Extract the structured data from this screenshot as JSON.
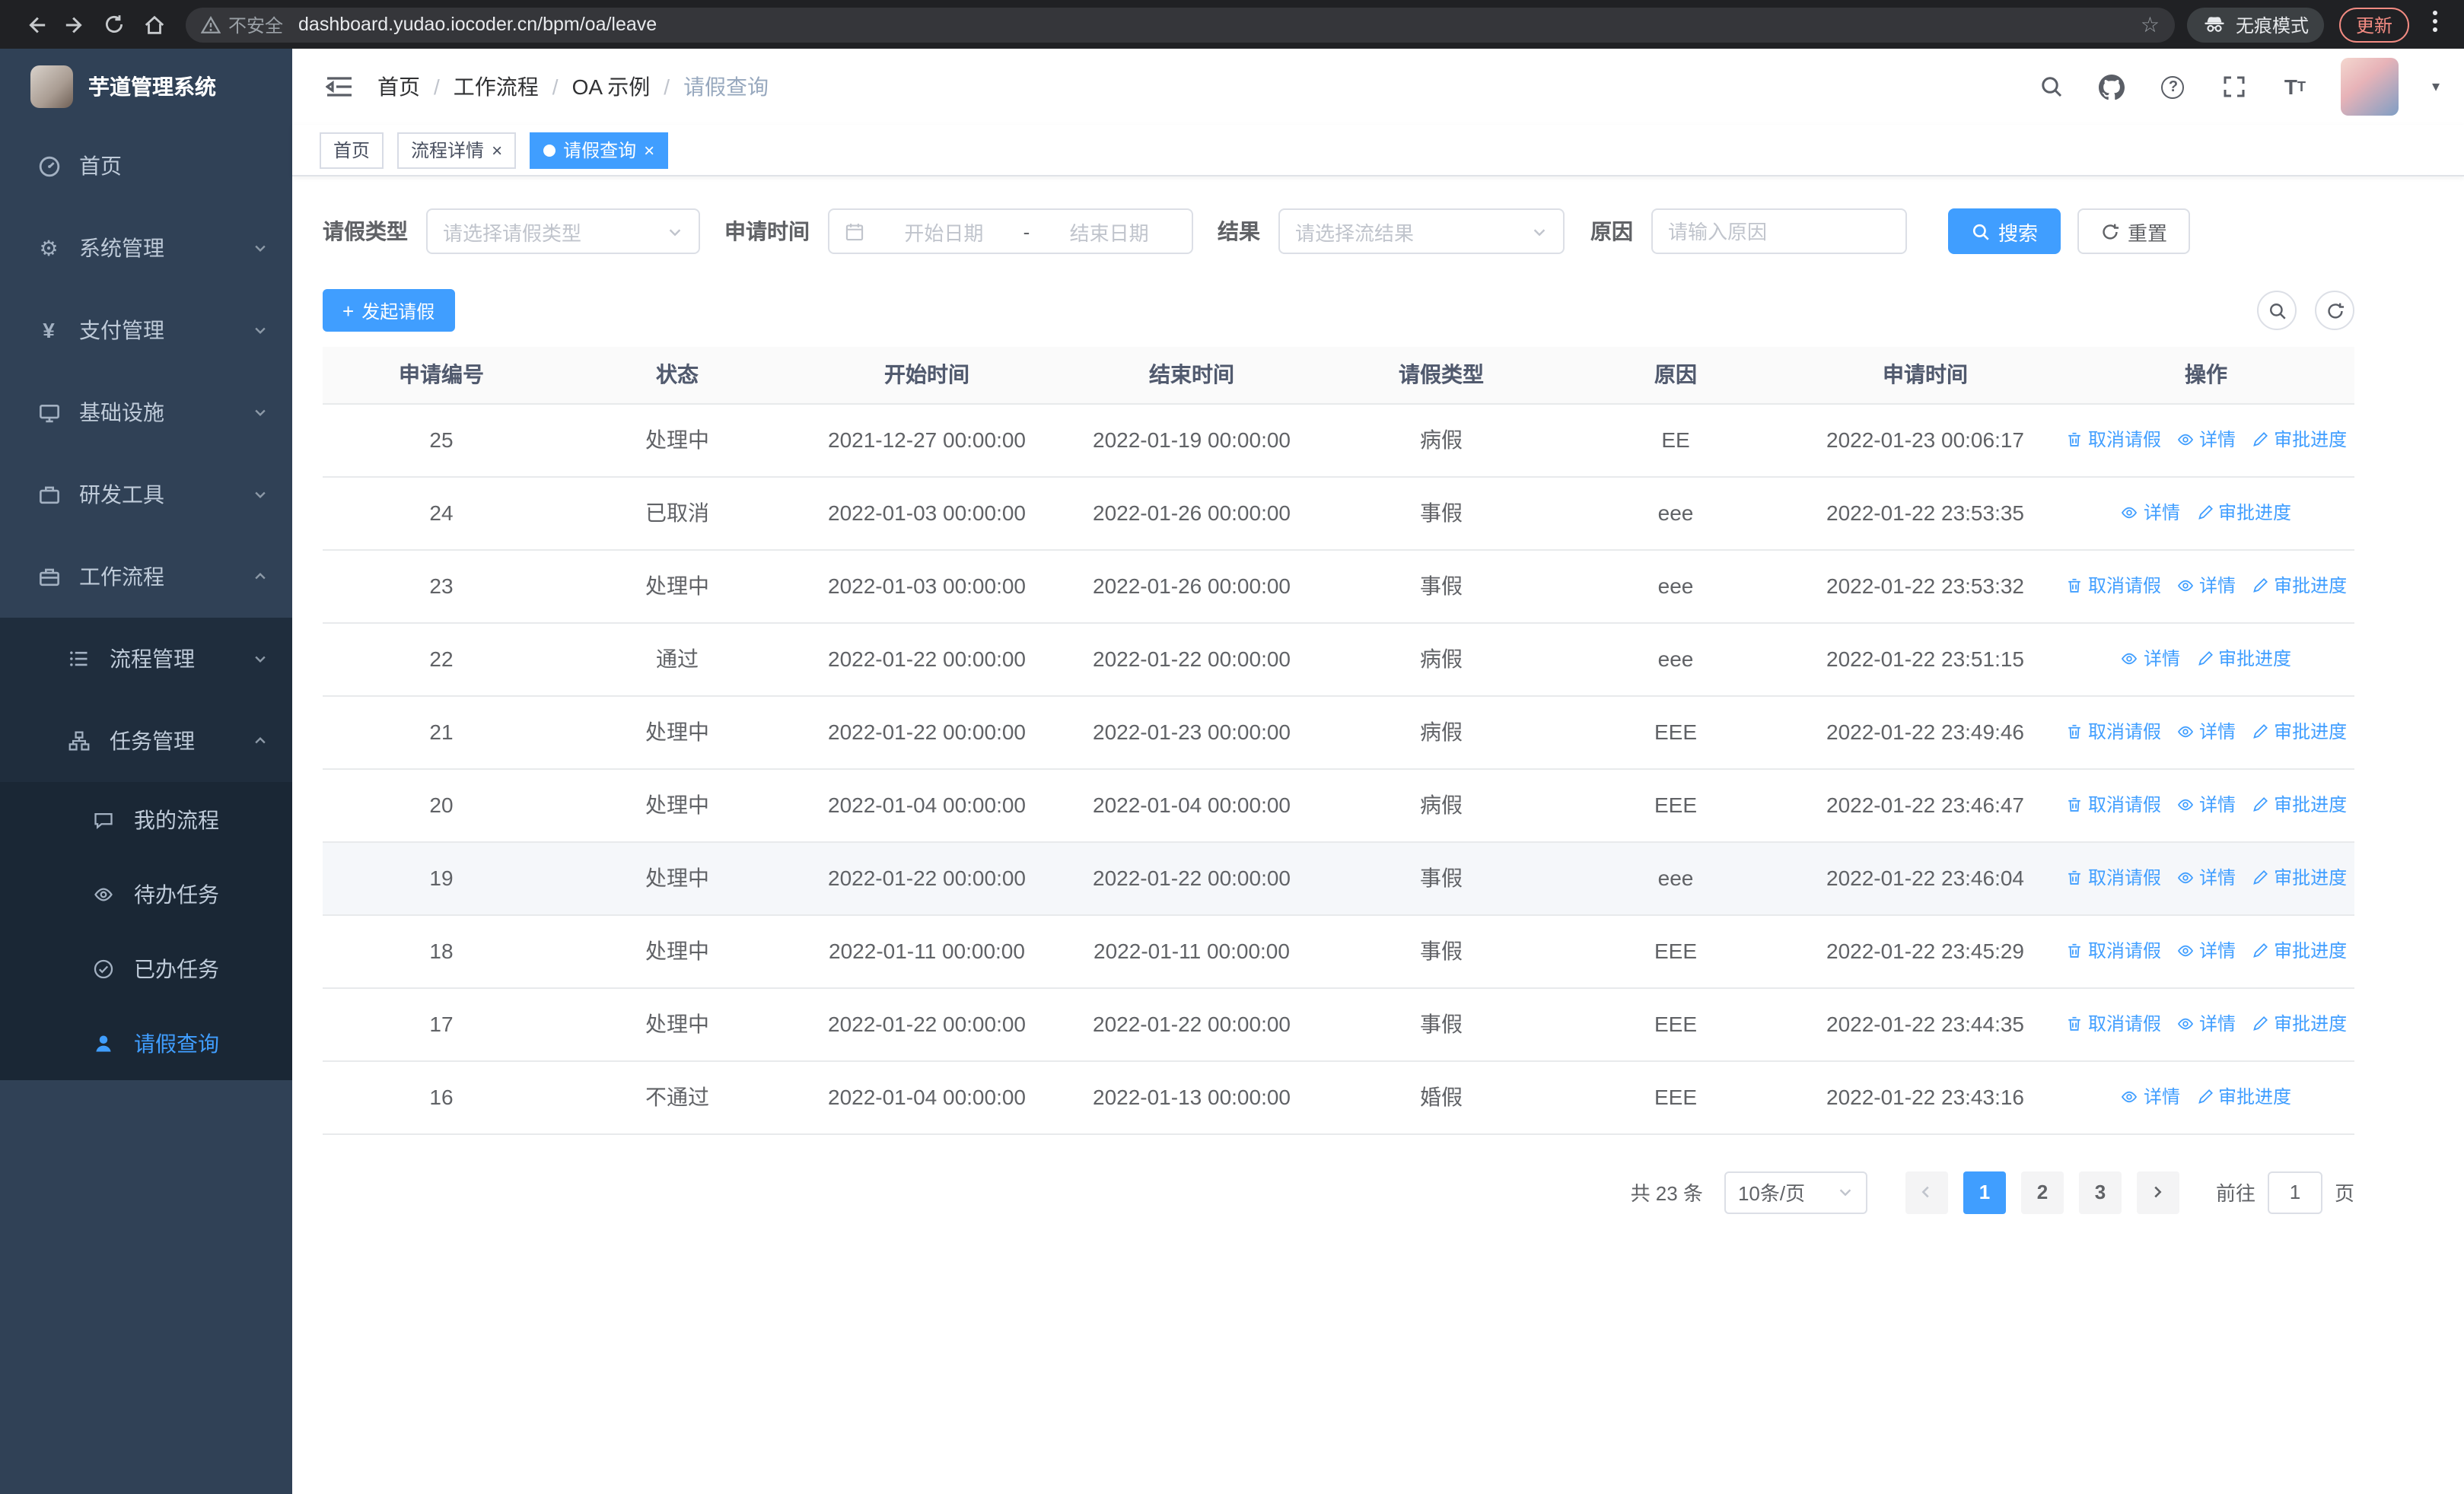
{
  "colors": {
    "accent": "#409eff",
    "sidebar_bg": "#304156",
    "submenu_bg": "#1f2d3d",
    "danger": "#f28b82"
  },
  "browser": {
    "security_warning": "不安全",
    "url": "dashboard.yudao.iocoder.cn/bpm/oa/leave",
    "incognito_label": "无痕模式",
    "update_label": "更新"
  },
  "sidebar": {
    "logo_title": "芋道管理系统",
    "menu": [
      {
        "label": "首页"
      },
      {
        "label": "系统管理"
      },
      {
        "label": "支付管理"
      },
      {
        "label": "基础设施"
      },
      {
        "label": "研发工具"
      },
      {
        "label": "工作流程"
      }
    ],
    "process_mgmt": "流程管理",
    "task_mgmt": "任务管理",
    "task_items": [
      {
        "label": "我的流程"
      },
      {
        "label": "待办任务"
      },
      {
        "label": "已办任务"
      },
      {
        "label": "请假查询"
      }
    ]
  },
  "header": {
    "breadcrumb": {
      "home": "首页",
      "workflow": "工作流程",
      "oa": "OA 示例",
      "current": "请假查询"
    }
  },
  "tabs": [
    {
      "label": "首页",
      "active": false,
      "closable": false
    },
    {
      "label": "流程详情",
      "active": false,
      "closable": true
    },
    {
      "label": "请假查询",
      "active": true,
      "closable": true
    }
  ],
  "filters": {
    "leave_type_label": "请假类型",
    "leave_type_placeholder": "请选择请假类型",
    "apply_time_label": "申请时间",
    "start_date_placeholder": "开始日期",
    "date_separator": "-",
    "end_date_placeholder": "结束日期",
    "result_label": "结果",
    "result_placeholder": "请选择流结果",
    "reason_label": "原因",
    "reason_placeholder": "请输入原因",
    "search_button": "搜索",
    "reset_button": "重置"
  },
  "toolbar": {
    "create_button": "发起请假"
  },
  "table": {
    "columns": [
      "申请编号",
      "状态",
      "开始时间",
      "结束时间",
      "请假类型",
      "原因",
      "申请时间",
      "操作"
    ],
    "column_keys": [
      "id",
      "status",
      "start",
      "end",
      "type",
      "reason",
      "applied"
    ],
    "action_labels": {
      "cancel": "取消请假",
      "detail": "详情",
      "progress": "审批进度"
    },
    "rows": [
      {
        "id": "25",
        "status": "处理中",
        "start": "2021-12-27 00:00:00",
        "end": "2022-01-19 00:00:00",
        "type": "病假",
        "reason": "EE",
        "applied": "2022-01-23 00:06:17",
        "actions": [
          "cancel",
          "detail",
          "progress"
        ],
        "highlighted": false
      },
      {
        "id": "24",
        "status": "已取消",
        "start": "2022-01-03 00:00:00",
        "end": "2022-01-26 00:00:00",
        "type": "事假",
        "reason": "eee",
        "applied": "2022-01-22 23:53:35",
        "actions": [
          "detail",
          "progress"
        ],
        "highlighted": false
      },
      {
        "id": "23",
        "status": "处理中",
        "start": "2022-01-03 00:00:00",
        "end": "2022-01-26 00:00:00",
        "type": "事假",
        "reason": "eee",
        "applied": "2022-01-22 23:53:32",
        "actions": [
          "cancel",
          "detail",
          "progress"
        ],
        "highlighted": false
      },
      {
        "id": "22",
        "status": "通过",
        "start": "2022-01-22 00:00:00",
        "end": "2022-01-22 00:00:00",
        "type": "病假",
        "reason": "eee",
        "applied": "2022-01-22 23:51:15",
        "actions": [
          "detail",
          "progress"
        ],
        "highlighted": false
      },
      {
        "id": "21",
        "status": "处理中",
        "start": "2022-01-22 00:00:00",
        "end": "2022-01-23 00:00:00",
        "type": "病假",
        "reason": "EEE",
        "applied": "2022-01-22 23:49:46",
        "actions": [
          "cancel",
          "detail",
          "progress"
        ],
        "highlighted": false
      },
      {
        "id": "20",
        "status": "处理中",
        "start": "2022-01-04 00:00:00",
        "end": "2022-01-04 00:00:00",
        "type": "病假",
        "reason": "EEE",
        "applied": "2022-01-22 23:46:47",
        "actions": [
          "cancel",
          "detail",
          "progress"
        ],
        "highlighted": false
      },
      {
        "id": "19",
        "status": "处理中",
        "start": "2022-01-22 00:00:00",
        "end": "2022-01-22 00:00:00",
        "type": "事假",
        "reason": "eee",
        "applied": "2022-01-22 23:46:04",
        "actions": [
          "cancel",
          "detail",
          "progress"
        ],
        "highlighted": true
      },
      {
        "id": "18",
        "status": "处理中",
        "start": "2022-01-11 00:00:00",
        "end": "2022-01-11 00:00:00",
        "type": "事假",
        "reason": "EEE",
        "applied": "2022-01-22 23:45:29",
        "actions": [
          "cancel",
          "detail",
          "progress"
        ],
        "highlighted": false
      },
      {
        "id": "17",
        "status": "处理中",
        "start": "2022-01-22 00:00:00",
        "end": "2022-01-22 00:00:00",
        "type": "事假",
        "reason": "EEE",
        "applied": "2022-01-22 23:44:35",
        "actions": [
          "cancel",
          "detail",
          "progress"
        ],
        "highlighted": false
      },
      {
        "id": "16",
        "status": "不通过",
        "start": "2022-01-04 00:00:00",
        "end": "2022-01-13 00:00:00",
        "type": "婚假",
        "reason": "EEE",
        "applied": "2022-01-22 23:43:16",
        "actions": [
          "detail",
          "progress"
        ],
        "highlighted": false
      }
    ]
  },
  "pagination": {
    "total_text": "共 23 条",
    "page_size": "10条/页",
    "pages": [
      "1",
      "2",
      "3"
    ],
    "active_page": "1",
    "goto_label": "前往",
    "goto_value": "1",
    "goto_suffix": "页"
  }
}
